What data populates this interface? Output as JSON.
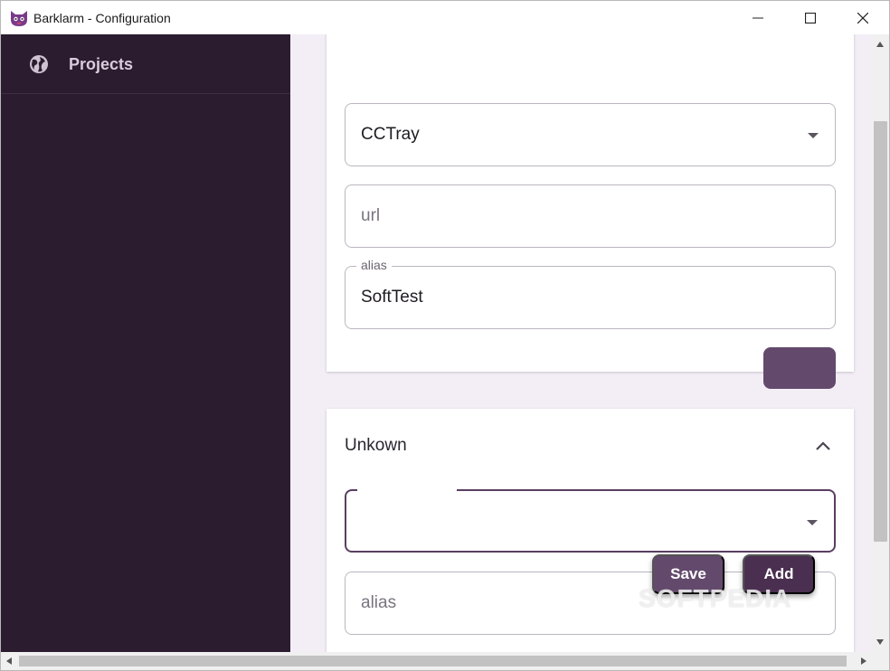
{
  "window": {
    "title": "Barklarm - Configuration",
    "icon": "barklarm-cat-icon",
    "controls": [
      "minimize-icon",
      "maximize-icon",
      "close-icon"
    ]
  },
  "sidebar": {
    "items": [
      {
        "label": "Projects",
        "icon": "globe-icon"
      }
    ]
  },
  "card1": {
    "type_select": {
      "value": "CCTray"
    },
    "url_field": {
      "placeholder": "url"
    },
    "alias_field": {
      "legend": "alias",
      "value": "SoftTest"
    }
  },
  "card2": {
    "title": "Unkown",
    "type_select": {
      "value": ""
    },
    "alias_field": {
      "placeholder": "alias"
    }
  },
  "actions": {
    "save_label": "Save",
    "add_label": "Add"
  },
  "watermark": "SOFTPEDIA",
  "colors": {
    "sidebar_bg": "#2b1c2f",
    "accent": "#634a6c",
    "accent_dark": "#4a2f50",
    "main_bg": "#f3eef6"
  }
}
